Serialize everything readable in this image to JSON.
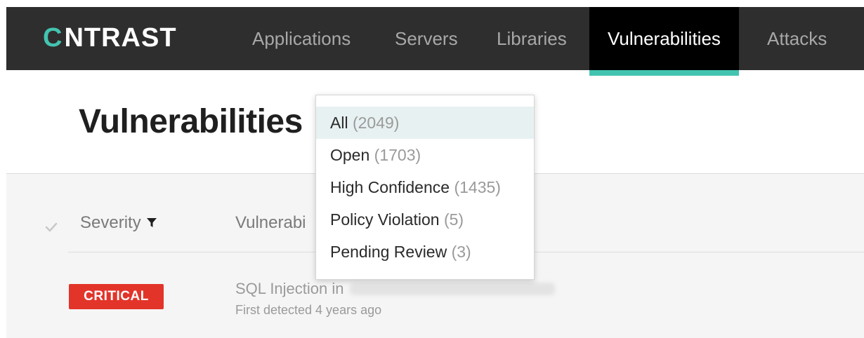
{
  "brand": {
    "logo_mark": "C",
    "logo_text": "NTRAST",
    "accent_color": "#43c4b0"
  },
  "nav": {
    "items": [
      {
        "label": "Applications",
        "active": false
      },
      {
        "label": "Servers",
        "active": false
      },
      {
        "label": "Libraries",
        "active": false
      },
      {
        "label": "Vulnerabilities",
        "active": true
      },
      {
        "label": "Attacks",
        "active": false
      }
    ]
  },
  "page": {
    "title": "Vulnerabilities"
  },
  "table": {
    "columns": {
      "severity": "Severity",
      "vulnerability": "Vulnerabi"
    },
    "rows": [
      {
        "severity_badge": "CRITICAL",
        "severity_color": "#e3342a",
        "title_prefix": "SQL Injection in",
        "subtitle": "First detected 4 years ago"
      }
    ]
  },
  "filter_dropdown": {
    "options": [
      {
        "label": "All",
        "count": "(2049)",
        "selected": true
      },
      {
        "label": "Open",
        "count": "(1703)",
        "selected": false
      },
      {
        "label": "High Confidence",
        "count": "(1435)",
        "selected": false
      },
      {
        "label": "Policy Violation",
        "count": "(5)",
        "selected": false
      },
      {
        "label": "Pending Review",
        "count": "(3)",
        "selected": false
      }
    ]
  },
  "icons": {
    "check": "check-icon",
    "filter": "filter-icon"
  }
}
